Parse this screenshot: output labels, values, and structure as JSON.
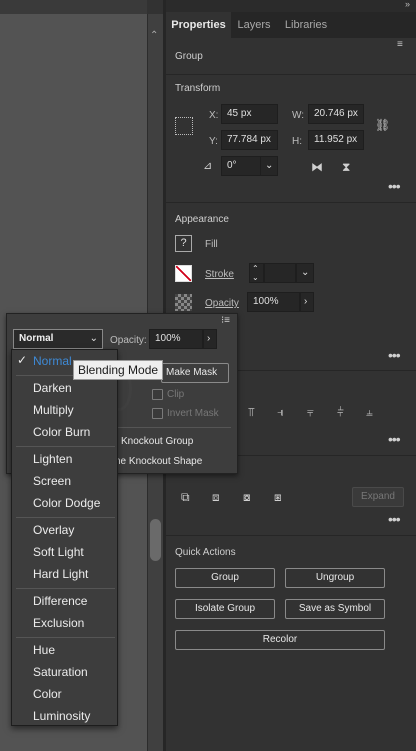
{
  "tabs": [
    "Properties",
    "Layers",
    "Libraries"
  ],
  "panel_menu_icon": "panel-menu-icon",
  "selection_type": "Group",
  "transform": {
    "title": "Transform",
    "x_label": "X:",
    "x_value": "45 px",
    "y_label": "Y:",
    "y_value": "77.784 px",
    "w_label": "W:",
    "w_value": "20.746 px",
    "h_label": "H:",
    "h_value": "11.952 px",
    "angle_value": "0°"
  },
  "appearance": {
    "title": "Appearance",
    "fill_label": "Fill",
    "stroke_label": "Stroke",
    "opacity_label": "Opacity",
    "opacity_value": "100%"
  },
  "popup": {
    "blend_value": "Normal",
    "opacity_label": "Opacity:",
    "opacity_value": "100%",
    "make_mask": "Make Mask",
    "clip": "Clip",
    "invert_mask": "Invert Mask",
    "knockout_group": "Knockout Group",
    "isolate_knockout": "ne Knockout Shape"
  },
  "blend_menu": {
    "selected": "Normal",
    "groups": [
      [
        "Normal"
      ],
      [
        "Darken",
        "Multiply",
        "Color Burn"
      ],
      [
        "Lighten",
        "Screen",
        "Color Dodge"
      ],
      [
        "Overlay",
        "Soft Light",
        "Hard Light"
      ],
      [
        "Difference",
        "Exclusion"
      ],
      [
        "Hue",
        "Saturation",
        "Color",
        "Luminosity"
      ]
    ]
  },
  "tooltip": "Blending Mode",
  "pathfinder": {
    "expand_label": "Expand"
  },
  "quick_actions": {
    "title": "Quick Actions",
    "group": "Group",
    "ungroup": "Ungroup",
    "isolate_group": "Isolate Group",
    "save_as_symbol": "Save as Symbol",
    "recolor": "Recolor"
  },
  "colors": {
    "accent": "#3e8ad6",
    "panel_bg": "#323232",
    "canvas_bg": "#535353",
    "tooltip_bg": "#eeeeee"
  }
}
